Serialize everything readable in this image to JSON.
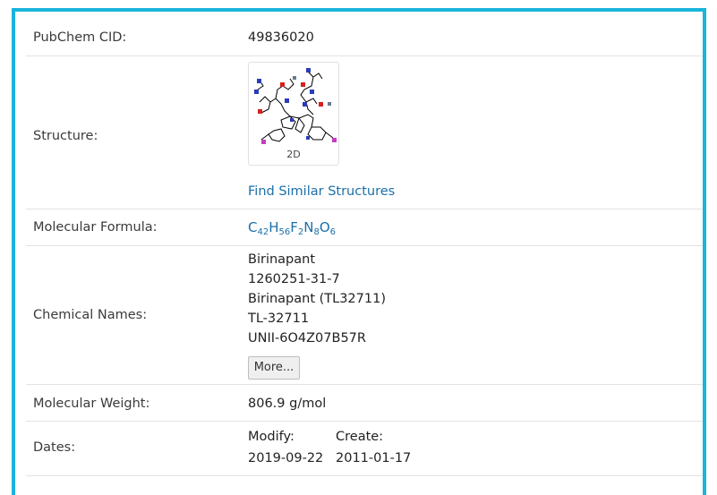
{
  "rows": {
    "cid": {
      "label": "PubChem CID:",
      "value": "49836020"
    },
    "structure": {
      "label": "Structure:",
      "thumb_caption": "2D",
      "link": "Find Similar Structures"
    },
    "formula": {
      "label": "Molecular Formula:",
      "parts": [
        {
          "el": "C",
          "n": "42"
        },
        {
          "el": "H",
          "n": "56"
        },
        {
          "el": "F",
          "n": "2"
        },
        {
          "el": "N",
          "n": "8"
        },
        {
          "el": "O",
          "n": "6"
        }
      ]
    },
    "names": {
      "label": "Chemical Names:",
      "items": [
        "Birinapant",
        "1260251-31-7",
        "Birinapant (TL32711)",
        "TL-32711",
        "UNII-6O4Z07B57R"
      ],
      "more_button": "More..."
    },
    "weight": {
      "label": "Molecular Weight:",
      "value": "806.9 g/mol"
    },
    "dates": {
      "label": "Dates:",
      "modify_label": "Modify:",
      "modify_value": "2019-09-22",
      "create_label": "Create:",
      "create_value": "2011-01-17"
    }
  },
  "colors": {
    "frame": "#19b4dc",
    "link": "#1b6fa8"
  }
}
